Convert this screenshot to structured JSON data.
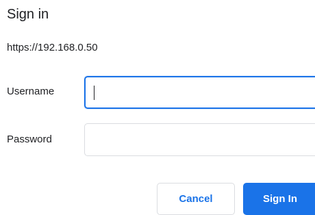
{
  "dialog": {
    "title": "Sign in",
    "origin": "https://192.168.0.50"
  },
  "form": {
    "username": {
      "label": "Username",
      "value": ""
    },
    "password": {
      "label": "Password",
      "value": ""
    }
  },
  "buttons": {
    "cancel": "Cancel",
    "sign_in": "Sign In"
  },
  "colors": {
    "accent": "#1a73e8",
    "border": "#dadce0",
    "text": "#202124"
  }
}
